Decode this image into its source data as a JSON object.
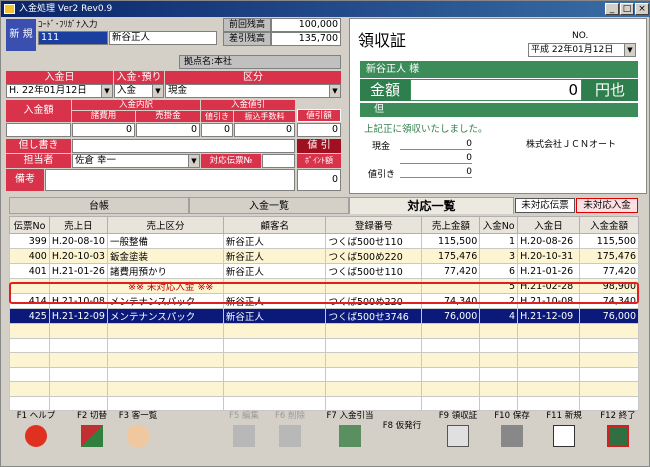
{
  "window": {
    "title": "入金処理 Ver2 Rev0.9"
  },
  "header": {
    "mode": "新 規",
    "code_label": "ｺｰﾄﾞ･ﾌﾘｶﾞﾅ入力",
    "code_value": "111",
    "name_value": "新谷正人",
    "prev_balance_label": "前回残高",
    "prev_balance": "100,000",
    "diff_balance_label": "差引残高",
    "diff_balance": "135,700",
    "branch": "拠点名:本社"
  },
  "form": {
    "nyukin_date_label": "入金日",
    "nyukin_date": "H. 22年01月12日",
    "nyukin_type_label": "入金･預り",
    "nyukin_type": "入金",
    "kubun_label": "区分",
    "kubun": "現金",
    "amount_label": "入金額",
    "detail_label": "入金内訳",
    "shohi_label": "諸費用",
    "uriage_label": "売掛金",
    "hikiage_label": "入金値引",
    "nebiki_label": "値引き",
    "furikomi_label": "振込手数料",
    "nebiki_btn": "値引額",
    "shohi_value": "0",
    "uriage_value": "0",
    "nebiki_value": "0",
    "furikomi_value": "0",
    "nebiki_amt": "0",
    "tadashi_label": "但し書き",
    "nebiki2_btn": "値 引",
    "tanto_label": "担当者",
    "tanto_value": "佐倉 幸一",
    "taiou_label": "対応伝票№",
    "point_label": "ﾎﾟｲﾝﾄ額",
    "point_value": "0",
    "biko_label": "備考"
  },
  "receipt": {
    "title": "領収証",
    "no_label": "NO.",
    "date": "平成 22年01月12日",
    "customer": "新谷正人 様",
    "amount_label": "金額",
    "amount": "0",
    "yen": "円也",
    "tadashi": "但",
    "received_text": "上記正に領収いたしました。",
    "genkin_label": "現金",
    "genkin": "0",
    "blank_value": "0",
    "nebiki_label": "値引き",
    "nebiki": "0",
    "company": "株式会社ＪＣＮオート"
  },
  "tabs": {
    "ledger": "台帳",
    "nyukin_list": "入金一覧",
    "taiou_list": "対応一覧",
    "mitaiou_denpyo": "未対応伝票",
    "mitaiou_nyukin": "未対応入金"
  },
  "grid": {
    "columns": [
      "伝票No",
      "売上日",
      "売上区分",
      "顧客名",
      "登録番号",
      "売上金額",
      "入金No",
      "入金日",
      "入金金額"
    ],
    "rows": [
      {
        "style": "white",
        "cells": [
          "399",
          "H.20-08-10",
          "一般整備",
          "新谷正人",
          "つくば500せ110",
          "115,500",
          "1",
          "H.20-08-26",
          "115,500"
        ]
      },
      {
        "style": "cream",
        "cells": [
          "400",
          "H.20-10-03",
          "鈑金塗装",
          "新谷正人",
          "つくば500め220",
          "175,476",
          "3",
          "H.20-10-31",
          "175,476"
        ]
      },
      {
        "style": "white",
        "cells": [
          "401",
          "H.21-01-26",
          "諸費用預かり",
          "新谷正人",
          "つくば500せ110",
          "77,420",
          "6",
          "H.21-01-26",
          "77,420"
        ]
      },
      {
        "style": "cream",
        "cells": [
          "",
          "",
          "※※ 未対応入金 ※※",
          "",
          "",
          "",
          "5",
          "H.21-02-28",
          "98,900"
        ]
      },
      {
        "style": "white",
        "cells": [
          "414",
          "H.21-10-08",
          "メンテナンスパック",
          "新谷正人",
          "つくば500め220",
          "74,340",
          "2",
          "H.21-10-08",
          "74,340"
        ]
      },
      {
        "style": "sel",
        "cells": [
          "425",
          "H.21-12-09",
          "メンテナンスパック",
          "新谷正人",
          "つくば500せ3746",
          "76,000",
          "4",
          "H.21-12-09",
          "76,000"
        ]
      }
    ]
  },
  "fkeys": [
    {
      "key": "F1",
      "label": "ヘルプ",
      "icon": "help-icon",
      "enabled": true
    },
    {
      "key": "F2",
      "label": "切替",
      "icon": "switch-icon",
      "enabled": true
    },
    {
      "key": "F3",
      "label": "客一覧",
      "icon": "customers-icon",
      "enabled": true
    },
    {
      "key": "F5",
      "label": "編集",
      "icon": "edit-icon",
      "enabled": false
    },
    {
      "key": "F6",
      "label": "削除",
      "icon": "delete-icon",
      "enabled": false
    },
    {
      "key": "F7",
      "label": "入金引当",
      "icon": "allocate-icon",
      "enabled": true
    },
    {
      "key": "F8",
      "label": "仮発行",
      "icon": "",
      "enabled": true
    },
    {
      "key": "F9",
      "label": "領収証",
      "icon": "printer-icon",
      "enabled": true
    },
    {
      "key": "F10",
      "label": "保存",
      "icon": "save-icon",
      "enabled": true
    },
    {
      "key": "F11",
      "label": "新規",
      "icon": "new-doc-icon",
      "enabled": true
    },
    {
      "key": "F12",
      "label": "終了",
      "icon": "exit-icon",
      "enabled": true
    }
  ]
}
